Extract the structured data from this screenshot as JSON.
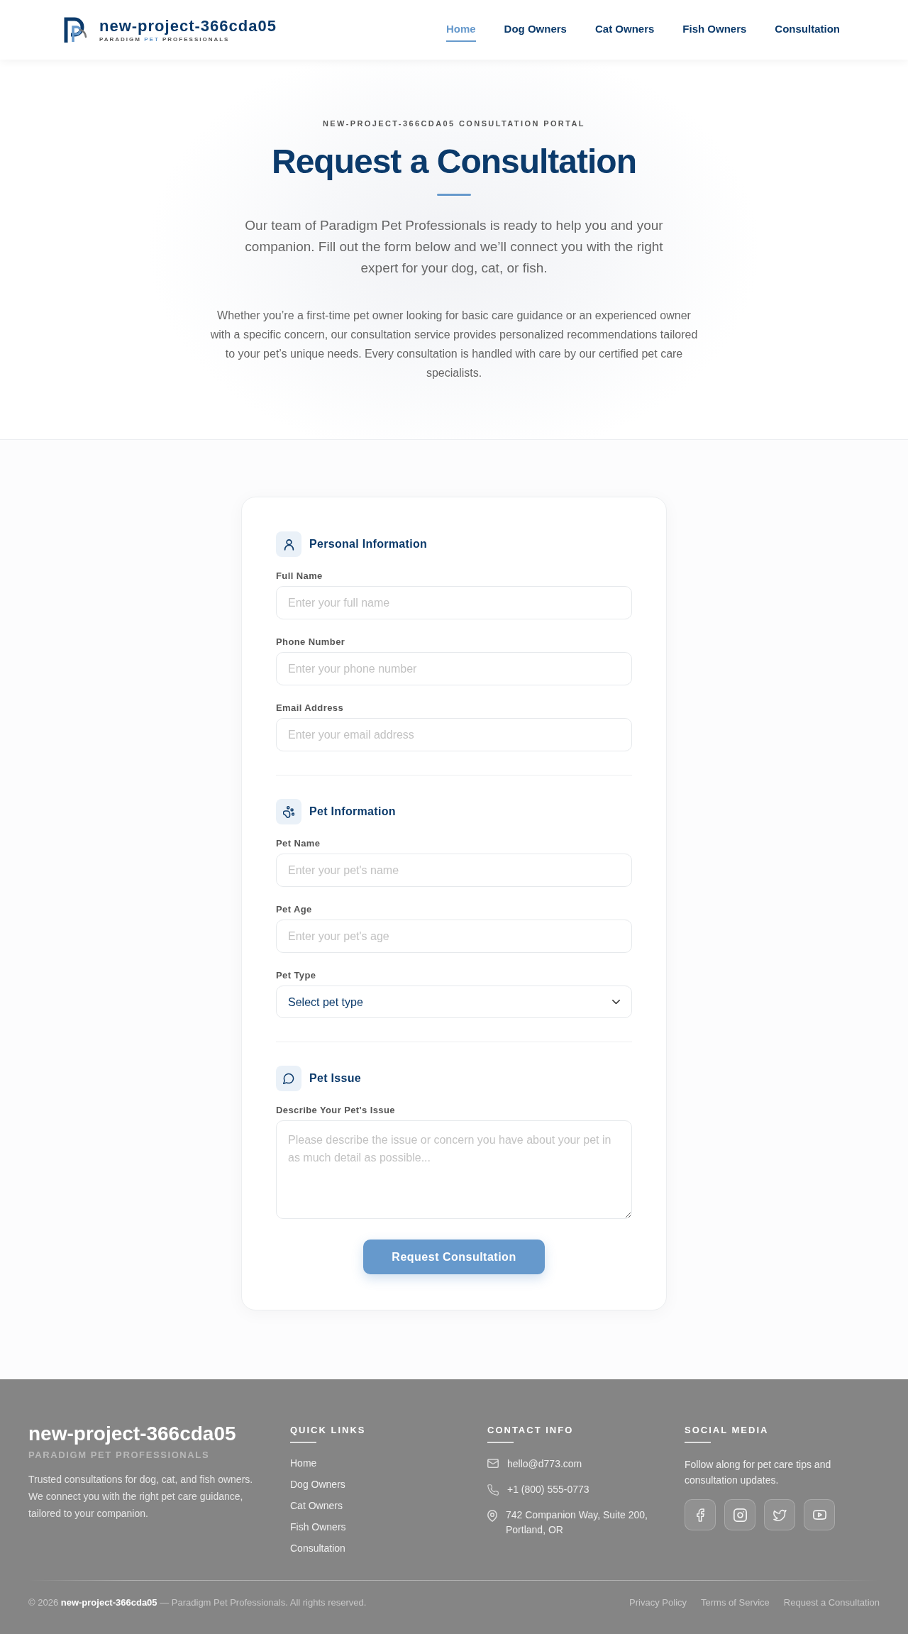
{
  "header": {
    "logo": {
      "name": "new-project-366cda05",
      "tagline": [
        {
          "text": "PARADIGM",
          "highlight": false
        },
        {
          "text": "PET",
          "highlight": true
        },
        {
          "text": "PROFESSIONALS",
          "highlight": false
        }
      ]
    },
    "nav": [
      {
        "label": "Home",
        "selected": true
      },
      {
        "label": "Dog Owners",
        "selected": false
      },
      {
        "label": "Cat Owners",
        "selected": false
      },
      {
        "label": "Fish Owners",
        "selected": false
      },
      {
        "label": "Consultation",
        "selected": false
      }
    ]
  },
  "hero": {
    "eyebrow": "NEW-PROJECT-366CDA05 CONSULTATION PORTAL",
    "title": "Request a Consultation",
    "lead": "Our team of Paradigm Pet Professionals is ready to help you and your companion. Fill out the form below and we’ll connect you with the right expert for your dog, cat, or fish.",
    "body": "Whether you’re a first-time pet owner looking for basic care guidance or an experienced owner with a specific concern, our consultation service provides personalized recommendations tailored to your pet’s unique needs. Every consultation is handled with care by our certified pet care specialists."
  },
  "form": {
    "sections": [
      {
        "title": "Personal Information",
        "fields": [
          {
            "kind": "input",
            "label": "Full Name",
            "placeholder": "Enter your full name"
          },
          {
            "kind": "input",
            "label": "Phone Number",
            "placeholder": "Enter your phone number"
          },
          {
            "kind": "input",
            "label": "Email Address",
            "placeholder": "Enter your email address"
          }
        ]
      },
      {
        "title": "Pet Information",
        "fields": [
          {
            "kind": "input",
            "label": "Pet Name",
            "placeholder": "Enter your pet's name"
          },
          {
            "kind": "input",
            "label": "Pet Age",
            "placeholder": "Enter your pet's age"
          },
          {
            "kind": "select",
            "label": "Pet Type",
            "value": "Select pet type"
          }
        ]
      },
      {
        "title": "Pet Issue",
        "fields": [
          {
            "kind": "textarea",
            "label": "Describe Your Pet's Issue",
            "placeholder": "Please describe the issue or concern you have about your pet in as much detail as possible..."
          }
        ]
      }
    ],
    "submit": "Request Consultation"
  },
  "footer": {
    "brand": {
      "name": "new-project-366cda05",
      "tagline": "PARADIGM PET PROFESSIONALS",
      "description": "Trusted consultations for dog, cat, and fish owners. We connect you with the right pet care guidance, tailored to your companion."
    },
    "quick_links": {
      "heading": "QUICK LINKS",
      "links": [
        "Home",
        "Dog Owners",
        "Cat Owners",
        "Fish Owners",
        "Consultation"
      ]
    },
    "contact": {
      "heading": "CONTACT INFO",
      "items": [
        "hello@d773.com",
        "+1 (800) 555-0773",
        "742 Companion Way, Suite 200, Portland, OR"
      ]
    },
    "social": {
      "heading": "SOCIAL MEDIA",
      "text": "Follow along for pet care tips and consultation updates."
    },
    "copyright": "© 2026 **new-project-366cda05** — Paradigm Pet Professionals. All rights reserved.",
    "legal_links": [
      "Privacy Policy",
      "Terms of Service",
      "Request a Consultation"
    ]
  }
}
